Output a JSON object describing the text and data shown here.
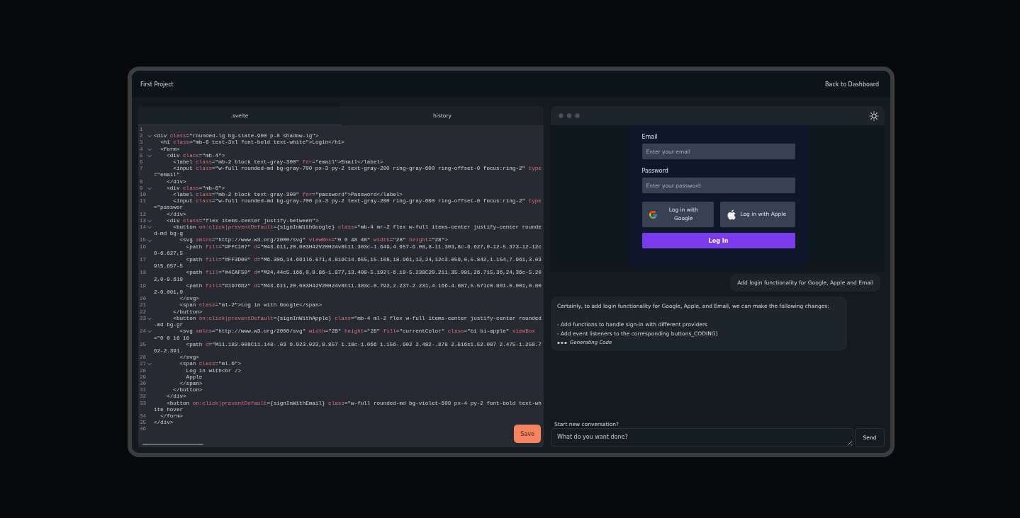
{
  "window": {
    "title": "First Project",
    "back_link": "Back to Dashboard"
  },
  "editor": {
    "tabs": [
      {
        "label": ".svelte",
        "selected": true
      },
      {
        "label": "history",
        "selected": false
      }
    ],
    "lines": [
      {
        "number": "1",
        "fold": false
      },
      {
        "number": "2",
        "fold": true,
        "code": "<div class=\"rounded-lg bg-slate-900 p-8 shadow-lg\">"
      },
      {
        "number": "3",
        "fold": false,
        "code": "  <h1 class=\"mb-6 text-3xl font-bold text-white\">Login</h1>"
      },
      {
        "number": "4",
        "fold": true,
        "code": "  <form>"
      },
      {
        "number": "5",
        "fold": true,
        "code": "    <div class=\"mb-4\">"
      },
      {
        "number": "6",
        "fold": false,
        "code": "      <label class=\"mb-2 block text-gray-300\" for=\"email\">Email</label>"
      },
      {
        "number": "7",
        "fold": false,
        "code": "      <input class=\"w-full rounded-md bg-gray-700 px-3 py-2 text-gray-200 ring-gray-600 ring-offset-0 focus:ring-2\" type=\"email\""
      },
      {
        "number": "8",
        "fold": false,
        "code": "    </div>"
      },
      {
        "number": "9",
        "fold": true,
        "code": "    <div class=\"mb-6\">"
      },
      {
        "number": "10",
        "fold": false,
        "code": "      <label class=\"mb-2 block text-gray-300\" for=\"password\">Password</label>"
      },
      {
        "number": "11",
        "fold": false,
        "code": "      <input class=\"w-full rounded-md bg-gray-700 px-3 py-2 text-gray-200 ring-gray-600 ring-offset-0 focus:ring-2\" type=\"passwor"
      },
      {
        "number": "12",
        "fold": false,
        "code": "    </div>"
      },
      {
        "number": "13",
        "fold": true,
        "code": "    <div class=\"flex items-center justify-between\">"
      },
      {
        "number": "14",
        "fold": true,
        "code": "      <button on:click|preventDefault={signInWithGoogle} class=\"mb-4 mr-2 flex w-full items-center justify-center rounded-md bg-g"
      },
      {
        "number": "15",
        "fold": true,
        "code": "        <svg xmlns=\"http://www.w3.org/2000/svg\" viewBox=\"0 0 48 48\" width=\"28\" height=\"28\">"
      },
      {
        "number": "16",
        "fold": false,
        "code": "          <path fill=\"#FFC107\" d=\"M43.611,20.083H42V20H24v8h11.303c-1.649,4.657-6.08,8-11.303,8c-6.627,0-12-5.373-12-12c0-6.627,5"
      },
      {
        "number": "17",
        "fold": false,
        "code": "          <path fill=\"#FF3D00\" d=\"M6.306,14.691l6.571,4.819C14.655,15.108,18.961,12,24,12c3.059,0,5.842,1.154,7.961,3.039l5.657-5"
      },
      {
        "number": "18",
        "fold": false,
        "code": "          <path fill=\"#4CAF50\" d=\"M24,44c5.166,0,9.86-1.977,13.409-5.192l-6.19-5.238C29.211,35.091,26.715,36,24,36c-5.202,0-9.619"
      },
      {
        "number": "19",
        "fold": false,
        "code": "          <path fill=\"#1976D2\" d=\"M43.611,20.083H42V20H24v8h11.303c-0.792,2.237-2.231,4.166-4.087,5.571c0.001-0.001,0.002-0.001,0"
      },
      {
        "number": "20",
        "fold": false,
        "code": "        </svg>"
      },
      {
        "number": "21",
        "fold": false,
        "code": "        <span class=\"ml-2\">Log in with Google</span>"
      },
      {
        "number": "22",
        "fold": false,
        "code": "      </button>"
      },
      {
        "number": "23",
        "fold": true,
        "code": "      <button on:click|preventDefault={signInWithApple} class=\"mb-4 ml-2 flex w-full items-center justify-center rounded-md bg-gr"
      },
      {
        "number": "24",
        "fold": true,
        "code": "        <svg xmlns=\"http://www.w3.org/2000/svg\" width=\"28\" height=\"28\" fill=\"currentColor\" class=\"bi bi-apple\" viewBox=\"0 0 16 16"
      },
      {
        "number": "25",
        "fold": false,
        "code": "          <path d=\"M11.182.008C11.148-.03 9.923.023,8.857 1.18c-1.066 1.156-.902 2.482-.878 2.516s1.52.087 2.475-1.258.762-2.391."
      },
      {
        "number": "26",
        "fold": false,
        "code": "        </svg>"
      },
      {
        "number": "27",
        "fold": true,
        "code": "        <span class=\"ml-6\">"
      },
      {
        "number": "28",
        "fold": false,
        "code": "          Log in with<br />"
      },
      {
        "number": "29",
        "fold": false,
        "code": "          Apple"
      },
      {
        "number": "30",
        "fold": false,
        "code": "        </span>"
      },
      {
        "number": "31",
        "fold": false,
        "code": "      </button>"
      },
      {
        "number": "32",
        "fold": false,
        "code": "    </div>"
      },
      {
        "number": "33",
        "fold": false,
        "code": "    <button on:click|preventDefault={signInWithEmail} class=\"w-full rounded-md bg-violet-600 px-4 py-2 font-bold text-white hover"
      },
      {
        "number": "34",
        "fold": false,
        "code": "  </form>"
      },
      {
        "number": "35",
        "fold": false,
        "code": "</div>"
      },
      {
        "number": "36",
        "fold": false
      }
    ],
    "save_button": "Save"
  },
  "preview": {
    "email_label": "Email",
    "email_placeholder": "Enter your email",
    "password_label": "Password",
    "password_placeholder": "Enter your password",
    "providers": [
      {
        "kind": "google",
        "label": "Log in with Google"
      },
      {
        "kind": "apple",
        "label": "Log in with Apple"
      }
    ],
    "login_button": "Log In"
  },
  "chat": {
    "messages": [
      {
        "kind": "user",
        "paragraphs": [
          "Add login functionality for Google, Apple and Email"
        ]
      },
      {
        "kind": "assistant",
        "paragraphs": [
          "Certainly, to add login functionality for Google, Apple, and Email, we can make the following changes:",
          "- Add functions to handle sign-in with different providers",
          "- Add event listeners to the corresponding buttons_CODING]"
        ],
        "status": "Generating Code"
      }
    ],
    "new_conversation": "Start new conversation?",
    "input_placeholder": "What do you want done?",
    "send_button": "Send"
  }
}
